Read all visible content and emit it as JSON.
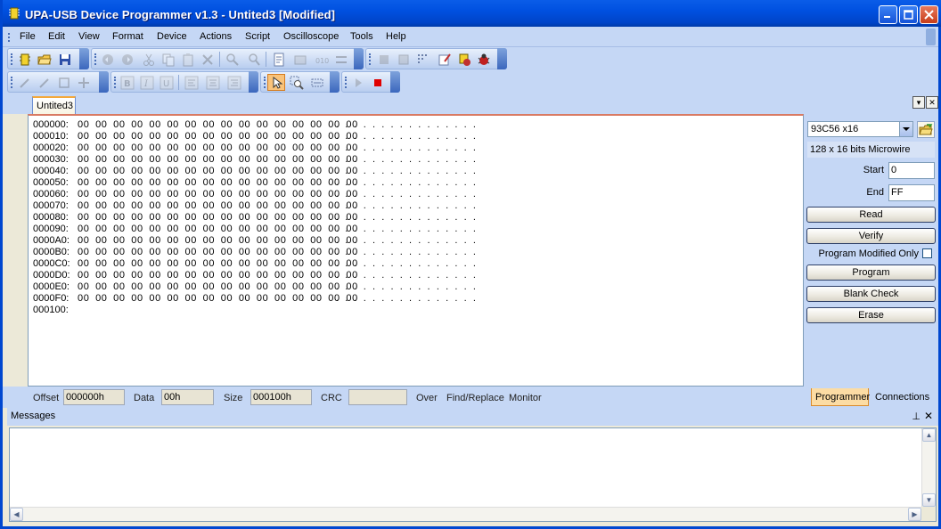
{
  "window": {
    "title": "UPA-USB Device Programmer v1.3 - Untited3 [Modified]"
  },
  "menu": [
    "File",
    "Edit",
    "View",
    "Format",
    "Device",
    "Actions",
    "Script",
    "Oscilloscope",
    "Tools",
    "Help"
  ],
  "document_tab": "Untited3",
  "hex": {
    "rows": [
      {
        "addr": "000000:",
        "bytes": "00 00 00 00 00 00 00 00 00 00 00 00 00 00 00 00",
        "ascii": "................"
      },
      {
        "addr": "000010:",
        "bytes": "00 00 00 00 00 00 00 00 00 00 00 00 00 00 00 00",
        "ascii": "................"
      },
      {
        "addr": "000020:",
        "bytes": "00 00 00 00 00 00 00 00 00 00 00 00 00 00 00 00",
        "ascii": "................"
      },
      {
        "addr": "000030:",
        "bytes": "00 00 00 00 00 00 00 00 00 00 00 00 00 00 00 00",
        "ascii": "................"
      },
      {
        "addr": "000040:",
        "bytes": "00 00 00 00 00 00 00 00 00 00 00 00 00 00 00 00",
        "ascii": "................"
      },
      {
        "addr": "000050:",
        "bytes": "00 00 00 00 00 00 00 00 00 00 00 00 00 00 00 00",
        "ascii": "................"
      },
      {
        "addr": "000060:",
        "bytes": "00 00 00 00 00 00 00 00 00 00 00 00 00 00 00 00",
        "ascii": "................"
      },
      {
        "addr": "000070:",
        "bytes": "00 00 00 00 00 00 00 00 00 00 00 00 00 00 00 00",
        "ascii": "................"
      },
      {
        "addr": "000080:",
        "bytes": "00 00 00 00 00 00 00 00 00 00 00 00 00 00 00 00",
        "ascii": "................"
      },
      {
        "addr": "000090:",
        "bytes": "00 00 00 00 00 00 00 00 00 00 00 00 00 00 00 00",
        "ascii": "................"
      },
      {
        "addr": "0000A0:",
        "bytes": "00 00 00 00 00 00 00 00 00 00 00 00 00 00 00 00",
        "ascii": "................"
      },
      {
        "addr": "0000B0:",
        "bytes": "00 00 00 00 00 00 00 00 00 00 00 00 00 00 00 00",
        "ascii": "................"
      },
      {
        "addr": "0000C0:",
        "bytes": "00 00 00 00 00 00 00 00 00 00 00 00 00 00 00 00",
        "ascii": "................"
      },
      {
        "addr": "0000D0:",
        "bytes": "00 00 00 00 00 00 00 00 00 00 00 00 00 00 00 00",
        "ascii": "................"
      },
      {
        "addr": "0000E0:",
        "bytes": "00 00 00 00 00 00 00 00 00 00 00 00 00 00 00 00",
        "ascii": "................"
      },
      {
        "addr": "0000F0:",
        "bytes": "00 00 00 00 00 00 00 00 00 00 00 00 00 00 00 00",
        "ascii": "................"
      },
      {
        "addr": "000100:",
        "bytes": "",
        "ascii": ""
      }
    ]
  },
  "programmer": {
    "device": "93C56 x16",
    "description": "128 x 16 bits Microwire",
    "start_label": "Start",
    "start_value": "0",
    "end_label": "End",
    "end_value": "FF",
    "read_label": "Read",
    "verify_label": "Verify",
    "program_modified_only_label": "Program Modified Only",
    "program_modified_only_checked": false,
    "program_label": "Program",
    "blank_check_label": "Blank Check",
    "erase_label": "Erase"
  },
  "status": {
    "offset_label": "Offset",
    "offset_value": "000000h",
    "data_label": "Data",
    "data_value": "00h",
    "size_label": "Size",
    "size_value": "000100h",
    "crc_label": "CRC",
    "crc_value": "",
    "over_label": "Over",
    "find_replace_label": "Find/Replace",
    "monitor_label": "Monitor"
  },
  "side_tabs": {
    "programmer": "Programmer",
    "connections": "Connections"
  },
  "messages": {
    "title": "Messages"
  },
  "colors": {
    "titlebar": "#0050e0",
    "chrome": "#c5d7f5",
    "active_tab": "#fcdca4",
    "stop_red": "#e00000"
  }
}
